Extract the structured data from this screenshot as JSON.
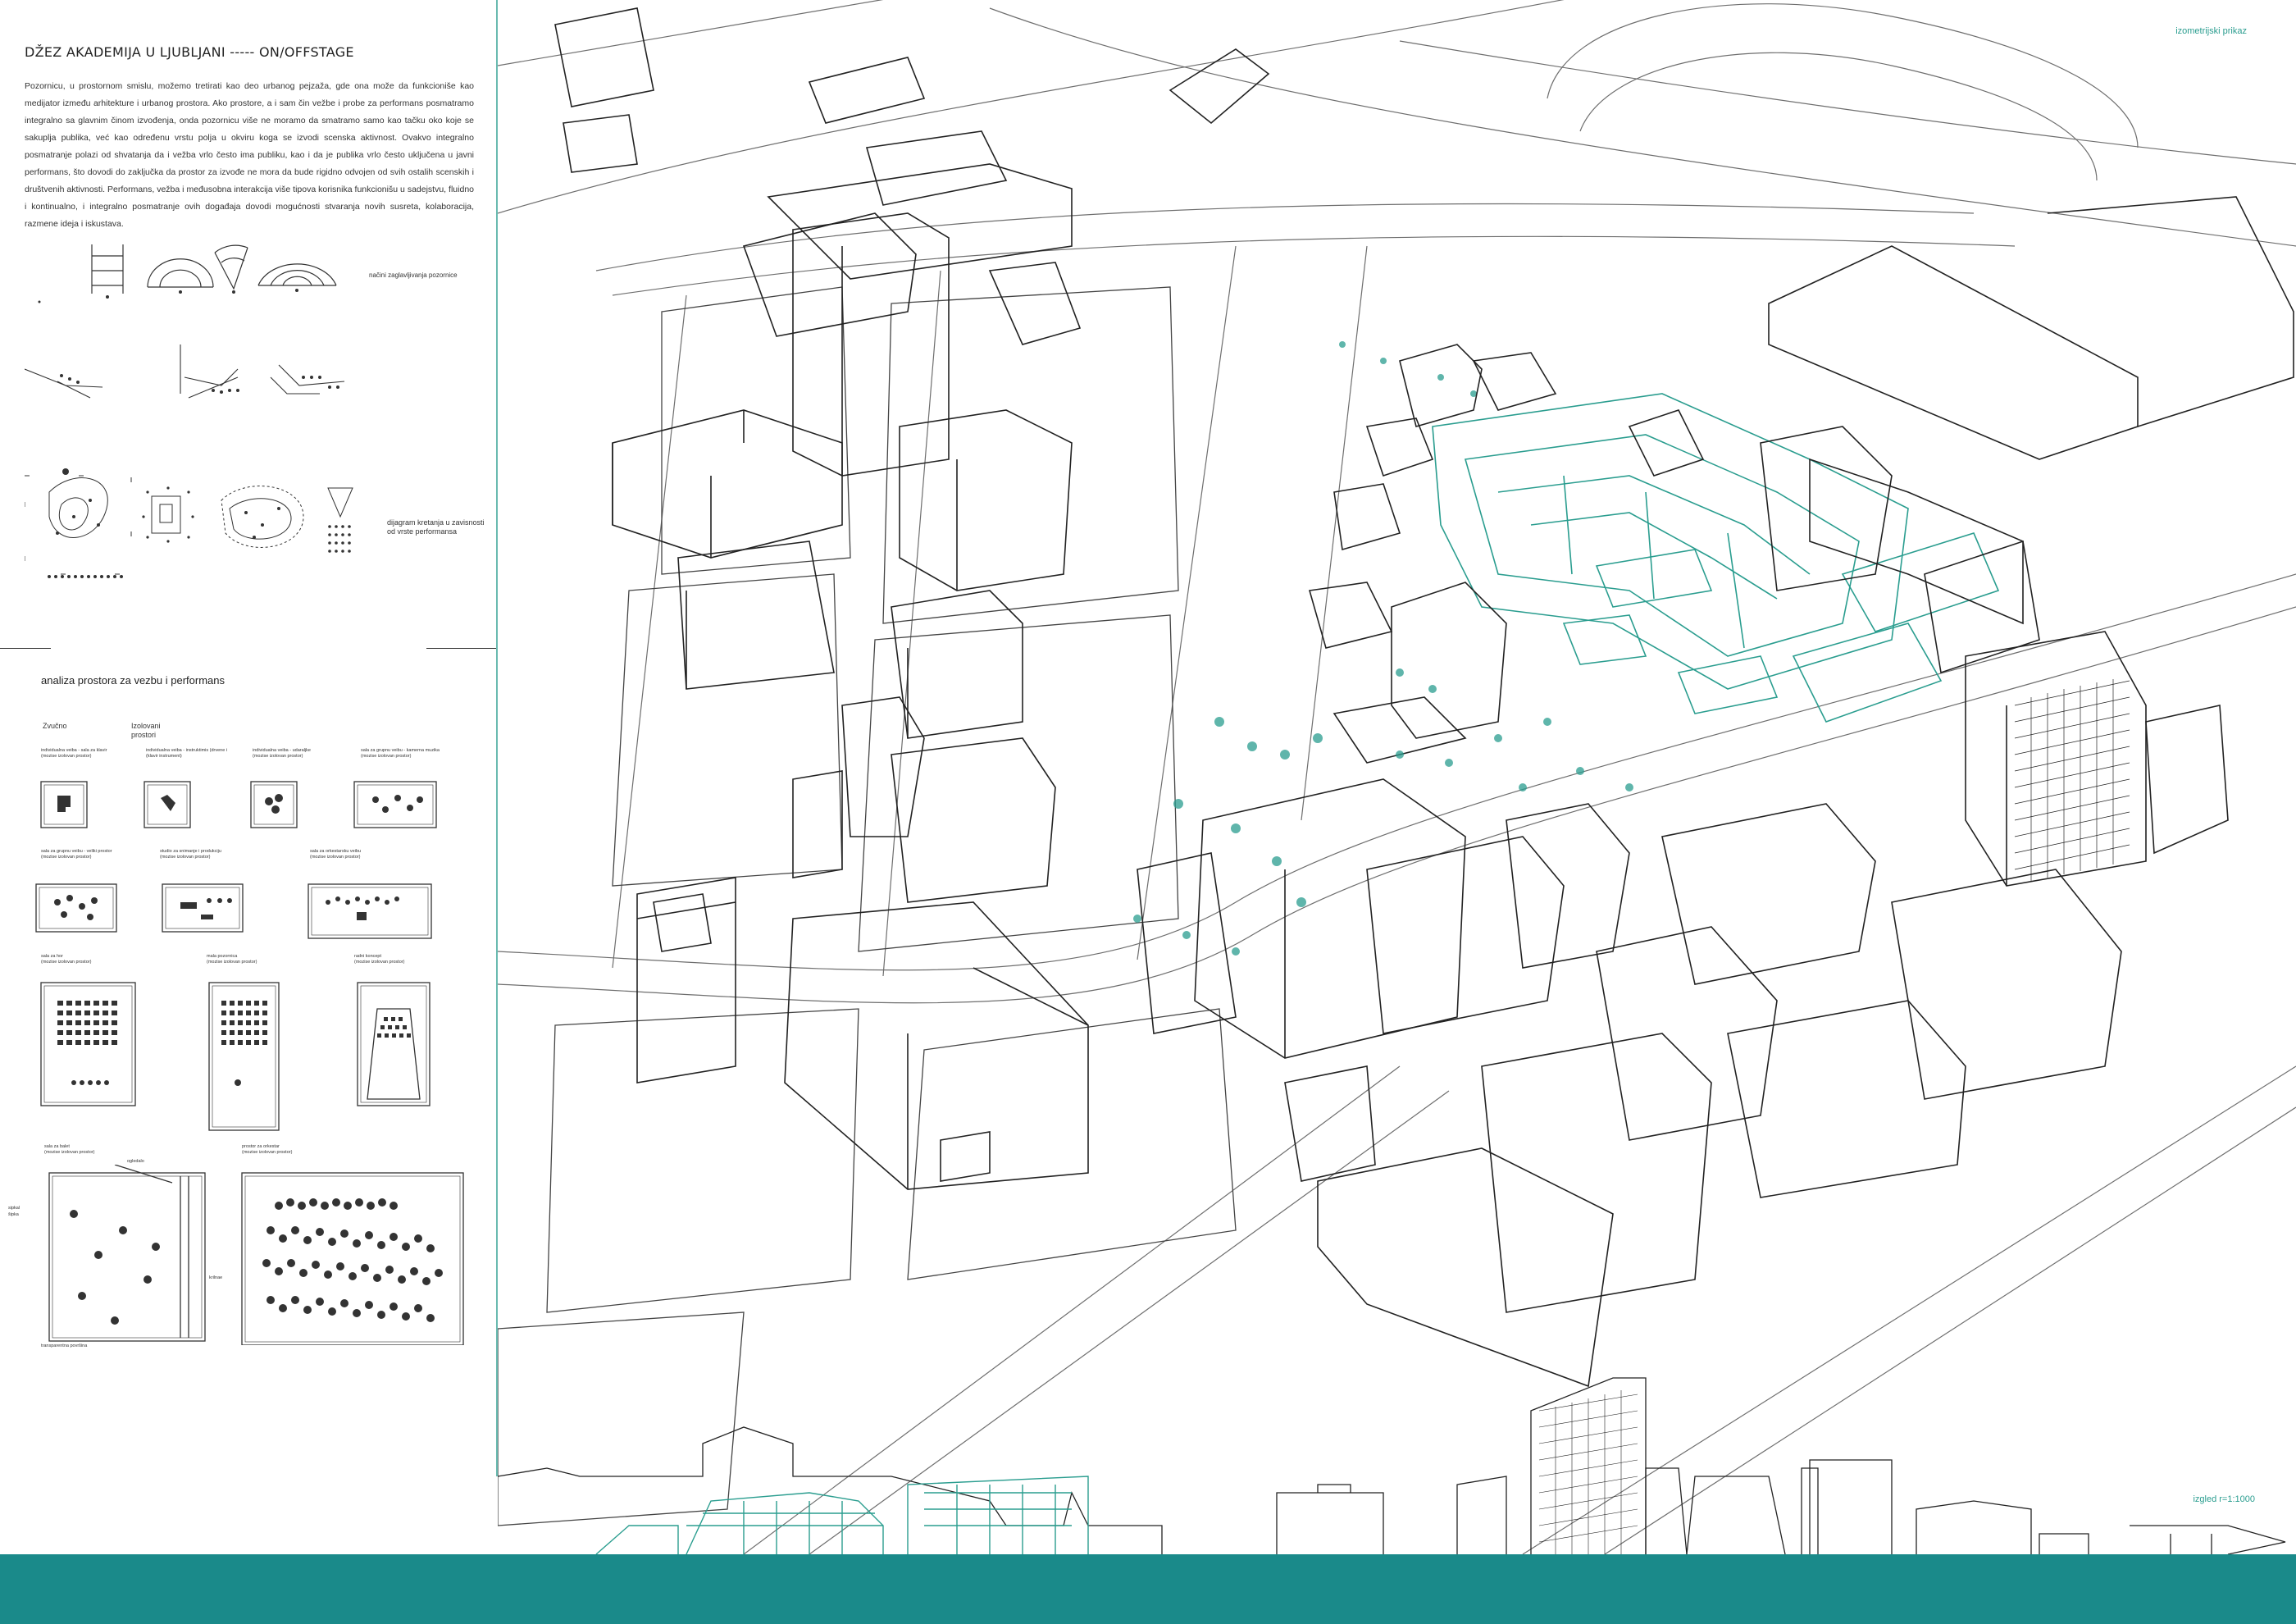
{
  "header": {
    "title": "DŽEZ AKADEMIJA U LJUBLJANI -----   ON/OFFSTAGE",
    "body": "Pozornicu, u prostornom smislu, možemo tretirati kao deo urbanog pejzaža,  gde ona može da funkcioniše kao medijator između arhitekture i urbanog prostora. Ako prostore, a i sam čin vežbe i probe za performans posmatramo integralno sa glavnim činom izvođenja, onda pozornicu više ne moramo da  smatramo samo kao tačku oko koje se sakuplja publika, već kao određenu vrstu polja u okviru koga se izvodi scenska aktivnost. Ovakvo integralno posmatranje polazi od shvatanja da i vežba vrlo često ima publiku, kao i da je publika vrlo često uključena u javni performans, što dovodi do zaključka da prostor za izvođe ne mora da bude rigidno odvojen od svih ostalih scenskih i društvenih aktivnosti. Performans, vežba i međusobna interakcija više tipova korisnika funkcionišu u sadejstvu, fluidno i kontinualno,  i integralno posmatranje ovih događaja dovodi mogućnosti stvaranja novih susreta, kolaboracija, razmene ideja i iskustava."
  },
  "diagram_labels": {
    "stage_modes": "načini zaglavljivanja pozornice",
    "movement": "dijagram kretanja u zavisnosti od vrste performansa"
  },
  "analysis": {
    "heading": "analiza prostora za vezbu i performans",
    "col1": "Zvučno",
    "col2a": "Izolovani",
    "col2b": "prostori",
    "rooms": [
      {
        "label": "individualna veiba - sala za klavir",
        "sub": "(mozise izolovan prostor)"
      },
      {
        "label": "individualna veiba - instruktimis (drvene i",
        "sub": "(klavir instrument)"
      },
      {
        "label": "individualna veiba - udaraljke",
        "sub": "(mozise izolovan prostor)"
      },
      {
        "label": "sala za grupnu veibu - kamerna muzika",
        "sub": "(mozise izolovan prostor)"
      },
      {
        "label": "sala za grupnu veibu - veliki prostor",
        "sub": "(mozise izolovan prostor)"
      },
      {
        "label": "studio za snimanje i produkciju",
        "sub": "(mozise izolovan prostor)"
      },
      {
        "label": "sala za orkestarsku veibu",
        "sub": "(mozise izolovan prostor)"
      },
      {
        "label": "sala za hor",
        "sub": "(mozise izolovan prostor)"
      },
      {
        "label": "mala pozornica",
        "sub": "(mozise izolovan prostor)"
      },
      {
        "label": "radni koncept",
        "sub": "(mozise izolovan prostor)"
      },
      {
        "label": "sala za balet",
        "sub": "(mozise izolovan prostor)"
      },
      {
        "label": "prostor za orkestar",
        "sub": "(mozise izolovan prostor)"
      }
    ],
    "ballet_notes": [
      "ogledalo",
      "sipkal",
      "šipka",
      "krilnae",
      "transparentna površina"
    ]
  },
  "map": {
    "label_top": "izometrijski prikaz",
    "label_bottom": "izgled r=1:1000"
  },
  "colors": {
    "accent": "#2a9d8f",
    "footer": "#1a8a8a",
    "line": "#333333"
  }
}
